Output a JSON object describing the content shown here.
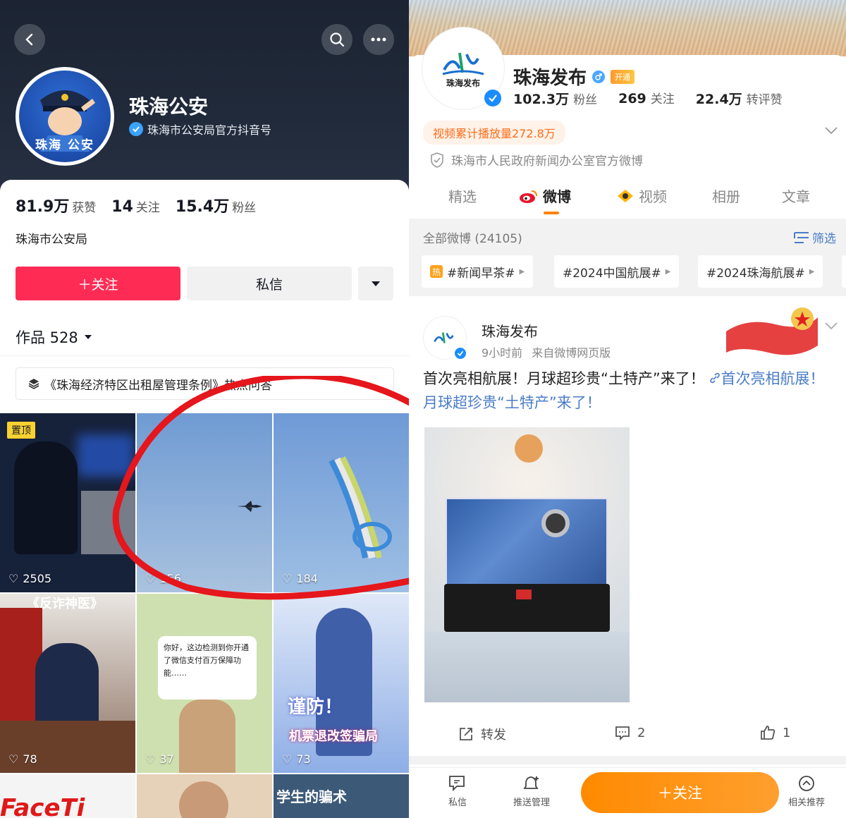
{
  "douyin": {
    "profile": {
      "name": "珠海公安",
      "verified_text": "珠海市公安局官方抖音号",
      "avatar_text": "珠海 公安"
    },
    "stats": [
      {
        "value": "81.9万",
        "label": "获赞"
      },
      {
        "value": "14",
        "label": "关注"
      },
      {
        "value": "15.4万",
        "label": "粉丝"
      }
    ],
    "org": "珠海市公安局",
    "buttons": {
      "follow": "＋关注",
      "message": "私信"
    },
    "works": "作品 528",
    "topic": "《珠海经济特区出租屋管理条例》热点问答",
    "videos": [
      {
        "likes": "2505",
        "pinned": "置顶",
        "bg": "#1b2740"
      },
      {
        "likes": "156",
        "bg": "#7fa6d6"
      },
      {
        "likes": "184",
        "bg": "#7ea8da"
      },
      {
        "likes": "78",
        "overlay": "《反诈神医》",
        "bg": "#8a6a5a"
      },
      {
        "likes": "37",
        "bubble": "你好，这边检测到你开通了微信支付百万保障功能……",
        "bg": "#d9e6c2"
      },
      {
        "likes": "73",
        "caption1": "谨防！",
        "caption2": "机票退改签骗局",
        "bg": "#9bb6e8"
      },
      {
        "caption": "FaceTi",
        "bg": "#f4f4f4"
      },
      {
        "bg": "#e6d2b8"
      },
      {
        "caption": "学生的骗术",
        "bg": "#3c5a78"
      }
    ]
  },
  "weibo": {
    "profile": {
      "name": "珠海发布",
      "avatar_text": "珠海发布",
      "vip": "开通",
      "stats": [
        {
          "value": "102.3万",
          "label": "粉丝"
        },
        {
          "value": "269",
          "label": "关注"
        },
        {
          "value": "22.4万",
          "label": "转评赞"
        }
      ],
      "play_count": "视频累计播放量272.8万",
      "description": "珠海市人民政府新闻办公室官方微博"
    },
    "tabs": [
      "精选",
      "微博",
      "视频",
      "相册",
      "文章"
    ],
    "active_tab": "微博",
    "all_weibo": "全部微博 (24105)",
    "filter": "筛选",
    "chips": [
      "#新闻早茶#",
      "#2024中国航展#",
      "#2024珠海航展#"
    ],
    "hot_label": "热",
    "post": {
      "author": "珠海发布",
      "time": "9小时前",
      "source": "来自微博网页版",
      "text": "首次亮相航展！月球超珍贵“土特产”来了！",
      "link_text": "首次亮相航展！月球超珍贵“土特产”来了！",
      "repost": "转发",
      "comments": "2",
      "likes": "1"
    },
    "bottom": {
      "message": "私信",
      "push": "推送管理",
      "follow": "＋关注",
      "recommend": "相关推荐"
    },
    "colors": {
      "accent": "#ff8200",
      "link": "#4b7cc7",
      "douyin_red": "#fe2c55"
    }
  }
}
